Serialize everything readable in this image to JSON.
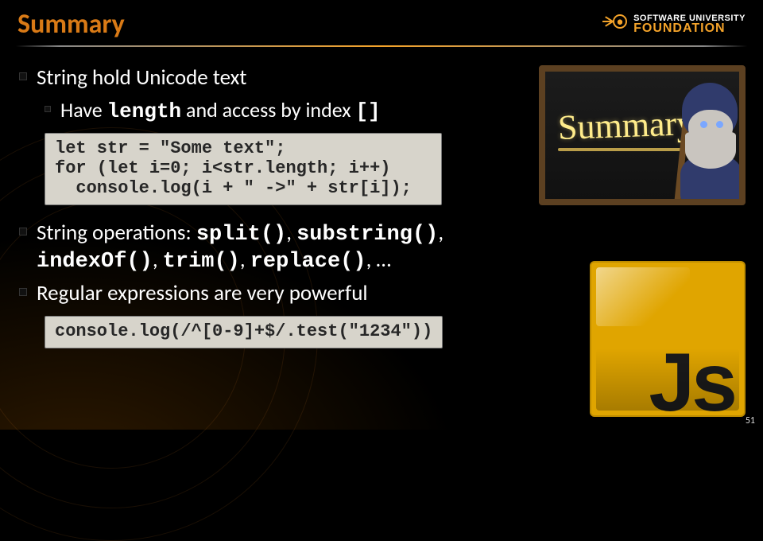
{
  "header": {
    "title": "Summary",
    "logo_line1": "SOFTWARE UNIVERSITY",
    "logo_line2": "FOUNDATION"
  },
  "bullets": {
    "b1": "String hold Unicode text",
    "b1a_pre": "Have ",
    "b1a_code1": "length",
    "b1a_mid": " and access by index ",
    "b1a_code2": "[]",
    "code1": "let str = \"Some text\";\nfor (let i=0; i<str.length; i++)\n  console.log(i + \" ->\" + str[i]);",
    "b2_pre": "String operations: ",
    "b2_ops": [
      "split()",
      "substring()",
      "indexOf()",
      "trim()",
      "replace()"
    ],
    "b2_sep": ", ",
    "b2_tail": ", …",
    "b3": "Regular expressions are very powerful",
    "code2": "console.log(/^[0-9]+$/.test(\"1234\"))"
  },
  "decor": {
    "summary_word": "Summary",
    "js_label": "Js"
  },
  "page_number": "51"
}
